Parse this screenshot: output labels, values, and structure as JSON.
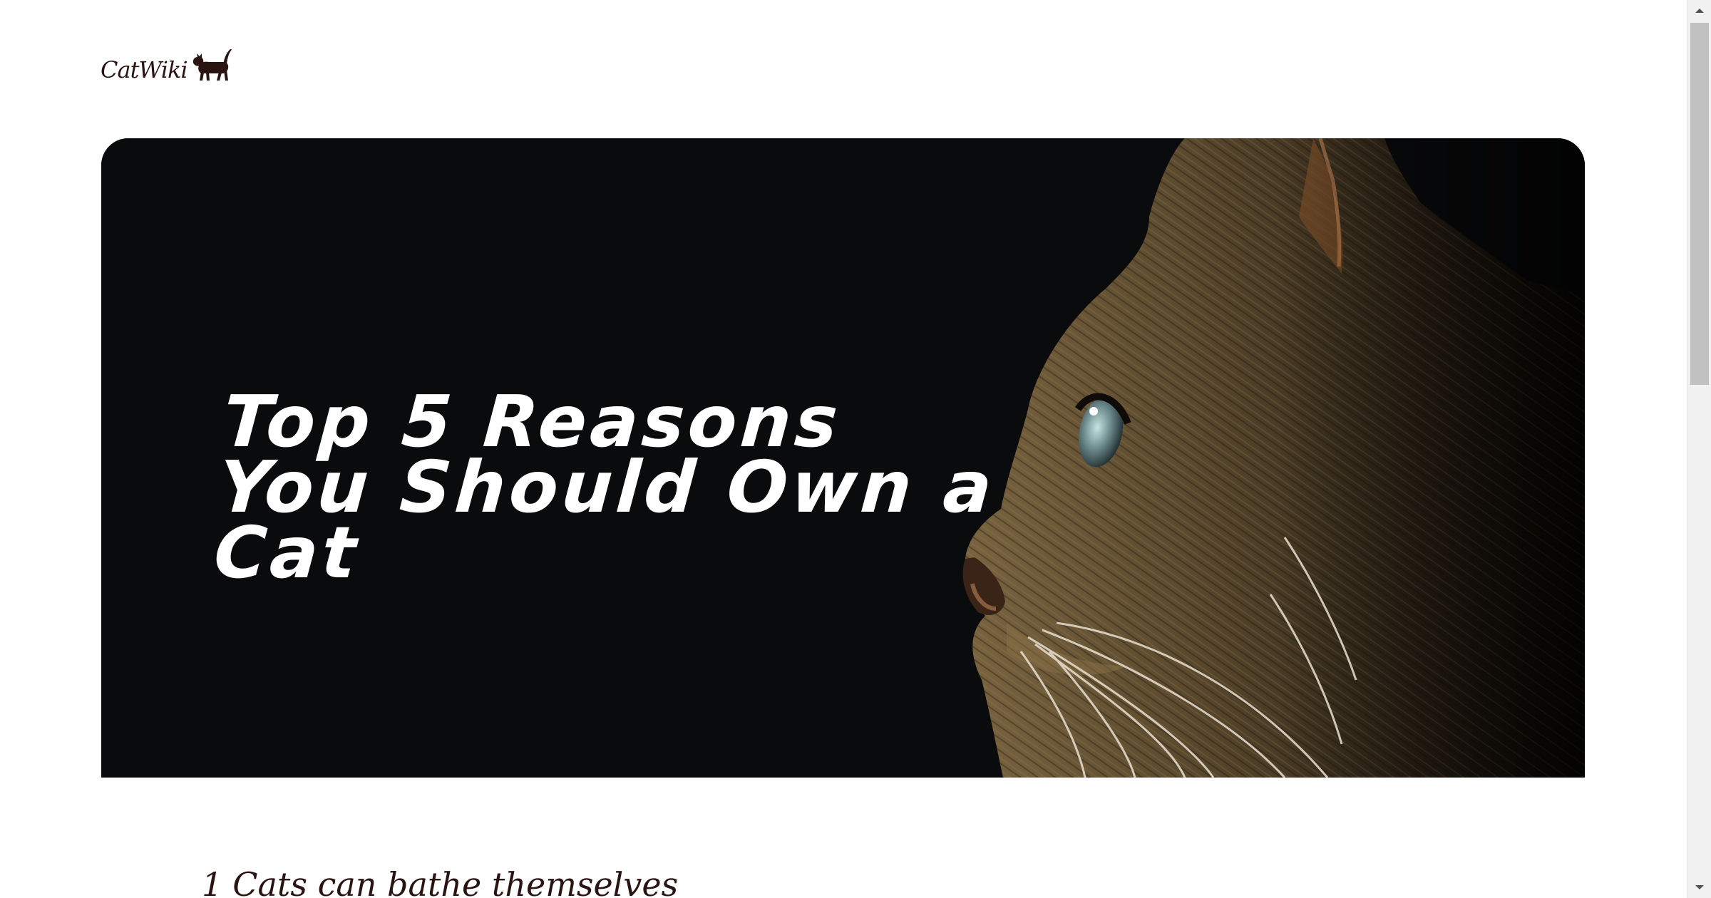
{
  "logo": {
    "text": "CatWiki",
    "icon": "cat-walking-icon"
  },
  "hero": {
    "title": "Top 5 Reasons You Should Own a Cat",
    "image": "cat-profile-photo"
  },
  "article": {
    "first_item_number": "1",
    "first_item_title": "Cats can bathe themselves"
  },
  "colors": {
    "text_dark": "#2a1412",
    "hero_bg": "#0a0b0d",
    "hero_title": "#ffffff",
    "scrollbar_track": "#f1f1f1",
    "scrollbar_thumb": "#c1c1c1"
  },
  "scrollbar": {
    "up_icon": "scroll-up-arrow-icon",
    "down_icon": "scroll-down-arrow-icon"
  }
}
